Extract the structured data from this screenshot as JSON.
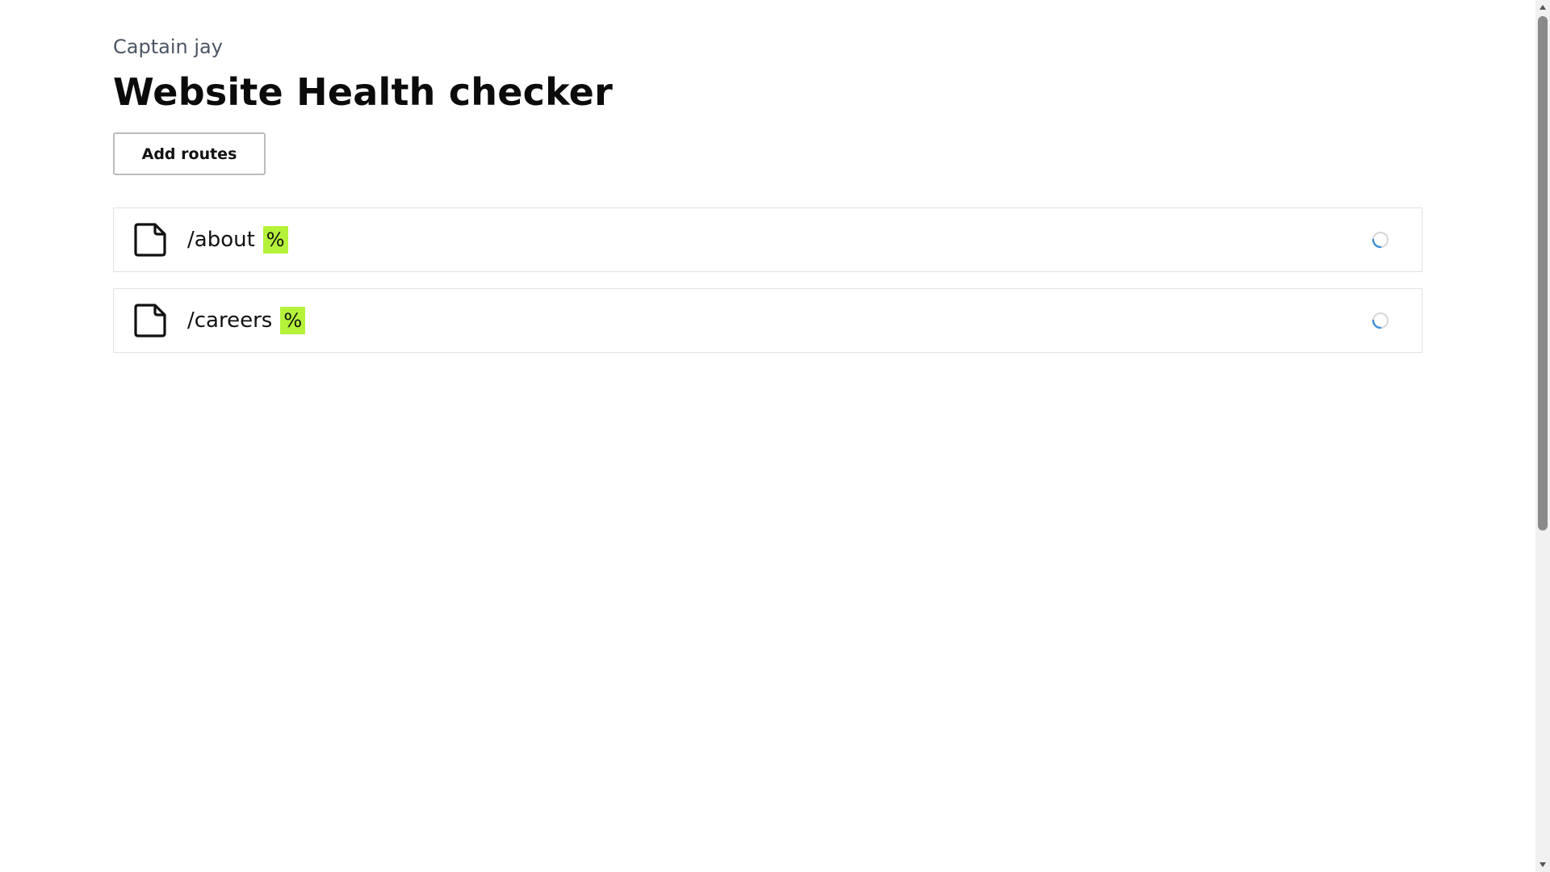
{
  "header": {
    "owner": "Captain jay",
    "title": "Website Health checker"
  },
  "actions": {
    "add_routes_label": "Add routes"
  },
  "routes": [
    {
      "path": "/about",
      "badge": "%",
      "icon": "file-icon",
      "status": "loading"
    },
    {
      "path": "/careers",
      "badge": "%",
      "icon": "file-icon",
      "status": "loading"
    }
  ],
  "colors": {
    "badge_bg": "#b5f23a",
    "spinner": "#3b8fd9",
    "border": "#e2e2e2"
  }
}
